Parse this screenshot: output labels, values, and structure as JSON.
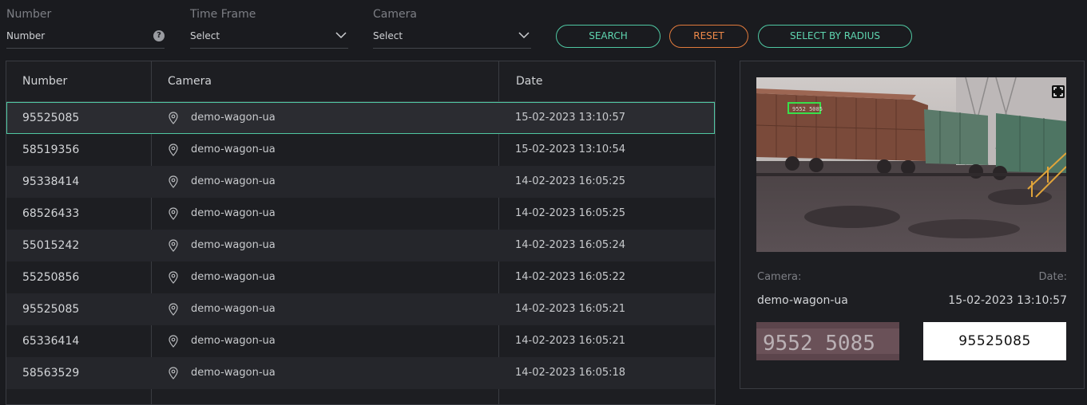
{
  "filters": {
    "number": {
      "label": "Number",
      "placeholder": "Number"
    },
    "time_frame": {
      "label": "Time Frame",
      "value": "Select"
    },
    "camera": {
      "label": "Camera",
      "value": "Select"
    }
  },
  "buttons": {
    "search": "SEARCH",
    "reset": "RESET",
    "select_by_radius": "SELECT BY RADIUS"
  },
  "table": {
    "headers": {
      "number": "Number",
      "camera": "Camera",
      "date": "Date"
    },
    "rows": [
      {
        "number": "95525085",
        "camera": "demo-wagon-ua",
        "date": "15-02-2023 13:10:57"
      },
      {
        "number": "58519356",
        "camera": "demo-wagon-ua",
        "date": "15-02-2023 13:10:54"
      },
      {
        "number": "95338414",
        "camera": "demo-wagon-ua",
        "date": "14-02-2023 16:05:25"
      },
      {
        "number": "68526433",
        "camera": "demo-wagon-ua",
        "date": "14-02-2023 16:05:25"
      },
      {
        "number": "55015242",
        "camera": "demo-wagon-ua",
        "date": "14-02-2023 16:05:24"
      },
      {
        "number": "55250856",
        "camera": "demo-wagon-ua",
        "date": "14-02-2023 16:05:22"
      },
      {
        "number": "95525085",
        "camera": "demo-wagon-ua",
        "date": "14-02-2023 16:05:21"
      },
      {
        "number": "65336414",
        "camera": "demo-wagon-ua",
        "date": "14-02-2023 16:05:21"
      },
      {
        "number": "58563529",
        "camera": "demo-wagon-ua",
        "date": "14-02-2023 16:05:18"
      }
    ]
  },
  "detail": {
    "camera_label": "Camera:",
    "date_label": "Date:",
    "camera": "demo-wagon-ua",
    "date": "15-02-2023 13:10:57",
    "plate_number": "95525085",
    "crop_text": "9552 5085"
  },
  "colors": {
    "accent": "#4fc7a2",
    "reset": "#e07a3c",
    "background": "#1a1b1f"
  }
}
